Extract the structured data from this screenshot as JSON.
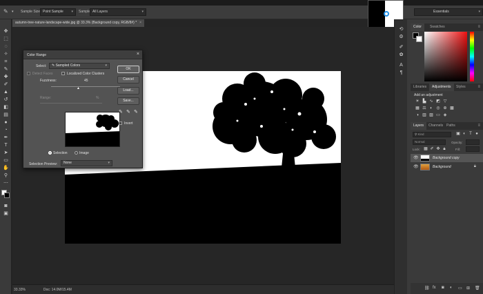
{
  "options_bar": {
    "sample_size_label": "Sample Size:",
    "sample_size_value": "Point Sample",
    "sample_label": "Sample:",
    "sample_value": "All Layers",
    "workspace": "Essentials"
  },
  "document": {
    "tab_title": "autumn-tree-nature-landscape-wide.jpg @ 33.3% (Background copy, RGB/8#) *",
    "zoom": "33.33%",
    "doc_size": "Doc: 14.0M/15.4M"
  },
  "color_panel": {
    "tabs": [
      "Color",
      "Swatches"
    ]
  },
  "adjustments_panel": {
    "tabs": [
      "Libraries",
      "Adjustments",
      "Styles"
    ],
    "heading": "Add an adjustment"
  },
  "layers_panel": {
    "tabs": [
      "Layers",
      "Channels",
      "Paths"
    ],
    "kind_placeholder": "Kind",
    "blend_mode": "Normal",
    "opacity_label": "Opacity:",
    "lock_label": "Lock:",
    "fill_label": "Fill:",
    "layers": [
      {
        "name": "Background copy",
        "active": true,
        "locked": false
      },
      {
        "name": "Background",
        "active": false,
        "locked": true
      }
    ]
  },
  "color_range_dialog": {
    "title": "Color Range",
    "select_label": "Select:",
    "select_value": "Sampled Colors",
    "detect_faces": "Detect Faces",
    "localized_clusters": "Localized Color Clusters",
    "fuzziness_label": "Fuzziness:",
    "fuzziness_value": "45",
    "range_label": "Range:",
    "range_unit": "%",
    "view_selection": "Selection",
    "view_image": "Image",
    "preview_label": "Selection Preview:",
    "preview_value": "None",
    "buttons": {
      "ok": "OK",
      "cancel": "Cancel",
      "load": "Load...",
      "save": "Save..."
    },
    "invert_label": "Invert"
  },
  "icons": {
    "tool_list": [
      "move-icon",
      "marquee-icon",
      "lasso-icon",
      "quick-select-icon",
      "crop-icon",
      "eyedropper-icon",
      "healing-icon",
      "brush-icon",
      "stamp-icon",
      "history-brush-icon",
      "eraser-icon",
      "gradient-icon",
      "blur-icon",
      "dodge-icon",
      "pen-icon",
      "type-icon",
      "path-select-icon",
      "shape-icon",
      "hand-icon",
      "zoom-icon"
    ]
  },
  "colors": {
    "accent": "#1f8fe6",
    "ui_dark": "#252525",
    "panel": "#3a3a3a"
  }
}
